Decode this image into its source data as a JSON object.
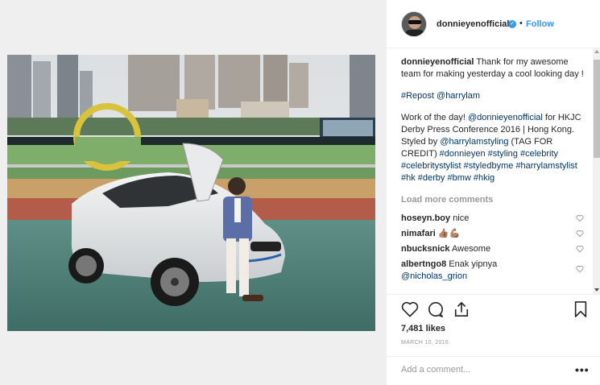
{
  "post": {
    "username": "donnieyenofficial",
    "dot": "•",
    "follow_label": "Follow"
  },
  "caption": {
    "username": "donnieyenofficial",
    "text": "Thank for my awesome team for making yesterday a cool looking day !",
    "repost": "#Repost @harrylam",
    "p2_a": "Work of the day! ",
    "p2_mention1": "@donnieyenofficial",
    "p2_b": " for HKJC Derby Press Conference 2016 | Hong Kong. Styled by ",
    "p2_mention2": "@harrylamstyling",
    "p2_c": " (TAG FOR CREDIT) ",
    "p2_tags": "#donnieyen #styling #celebrity #celebritystylist #styledbyme #harrylamstylist #hk #derby #bmw #hkig"
  },
  "load_more_label": "Load more comments",
  "comments": [
    {
      "user": "hoseyn.boy",
      "text": "nice"
    },
    {
      "user": "nimafari",
      "text": "👍🏽💪🏽"
    },
    {
      "user": "nbucksnick",
      "text": "Awesome"
    },
    {
      "user": "albertngo8",
      "text": "Enak yipnya",
      "mention": "@nicholas_grion"
    }
  ],
  "likes": "7,481 likes",
  "date": "MARCH 10, 2016",
  "add_comment_placeholder": "Add a comment...",
  "more_label": "•••",
  "icons": {
    "heart": "heart-icon",
    "comment": "comment-icon",
    "share": "share-icon",
    "bookmark": "bookmark-icon",
    "verified": "verified-badge-icon"
  },
  "colors": {
    "link": "#003569",
    "follow": "#3897f0",
    "muted": "#999999",
    "border": "#efefef"
  }
}
